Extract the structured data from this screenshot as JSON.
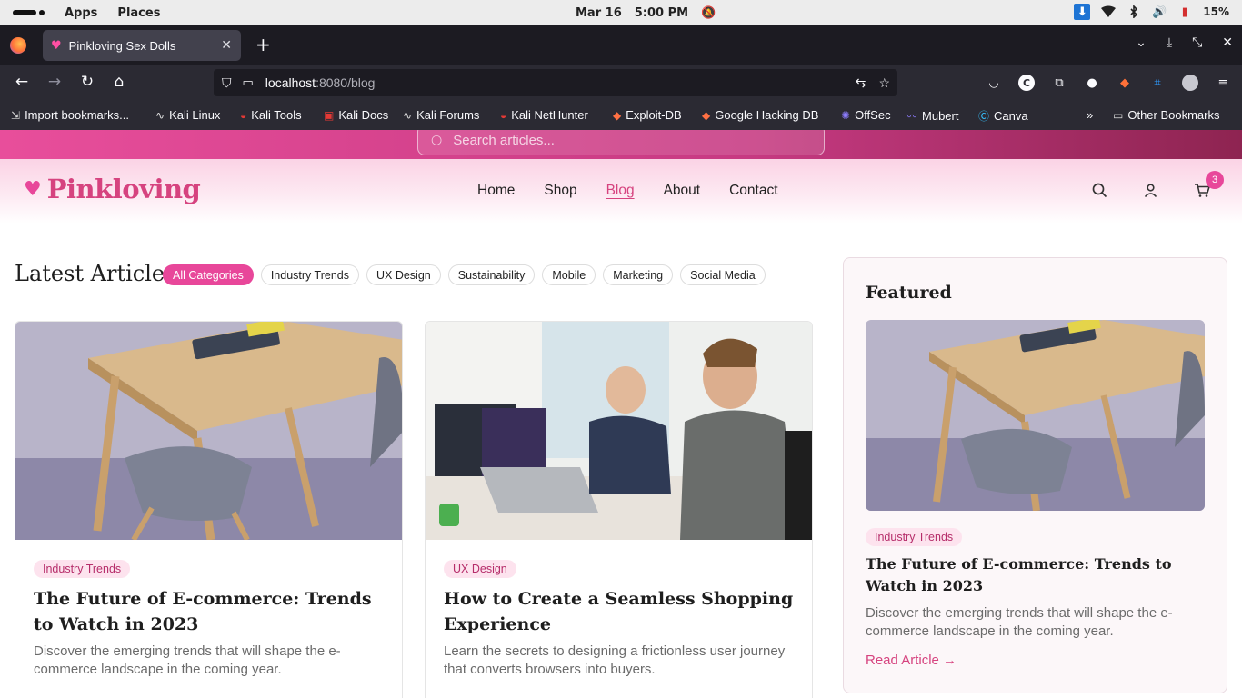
{
  "os": {
    "menu_apps": "Apps",
    "menu_places": "Places",
    "date": "Mar 16",
    "time": "5:00 PM",
    "battery": "15%"
  },
  "browser": {
    "tab_title": "Pinkloving Sex Dolls",
    "url_host": "localhost",
    "url_path": ":8080/blog",
    "bookmarks": [
      {
        "label": "Import bookmarks...",
        "icon": "import-icon"
      },
      {
        "label": "Kali Linux",
        "icon": "kali-dragon-icon"
      },
      {
        "label": "Kali Tools",
        "icon": "kali-tools-icon"
      },
      {
        "label": "Kali Docs",
        "icon": "kali-docs-icon"
      },
      {
        "label": "Kali Forums",
        "icon": "kali-dragon-icon"
      },
      {
        "label": "Kali NetHunter",
        "icon": "nethunter-icon"
      },
      {
        "label": "Exploit-DB",
        "icon": "exploitdb-icon"
      },
      {
        "label": "Google Hacking DB",
        "icon": "ghdb-icon"
      },
      {
        "label": "OffSec",
        "icon": "offsec-icon"
      },
      {
        "label": "Mubert",
        "icon": "mubert-icon"
      },
      {
        "label": "Canva",
        "icon": "canva-icon"
      }
    ],
    "other_bookmarks": "Other Bookmarks"
  },
  "site": {
    "search_placeholder": "Search articles...",
    "logo": "Pinkloving",
    "nav": [
      "Home",
      "Shop",
      "Blog",
      "About",
      "Contact"
    ],
    "active_nav": "Blog",
    "cart_count": "3",
    "accent_color": "#e8479a"
  },
  "articles": {
    "title": "Latest Articles",
    "filters": [
      "All Categories",
      "Industry Trends",
      "UX Design",
      "Sustainability",
      "Mobile",
      "Marketing",
      "Social Media"
    ],
    "active_filter": "All Categories",
    "cards": [
      {
        "tag": "Industry Trends",
        "title": "The Future of E-commerce: Trends to Watch in 2023",
        "desc": "Discover the emerging trends that will shape the e-commerce landscape in the coming year."
      },
      {
        "tag": "UX Design",
        "title": "How to Create a Seamless Shopping Experience",
        "desc": "Learn the secrets to designing a frictionless user journey that converts browsers into buyers."
      }
    ]
  },
  "featured": {
    "heading": "Featured",
    "tag": "Industry Trends",
    "title": "The Future of E-commerce: Trends to Watch in 2023",
    "desc": "Discover the emerging trends that will shape the e-commerce landscape in the coming year.",
    "link": "Read Article →"
  }
}
